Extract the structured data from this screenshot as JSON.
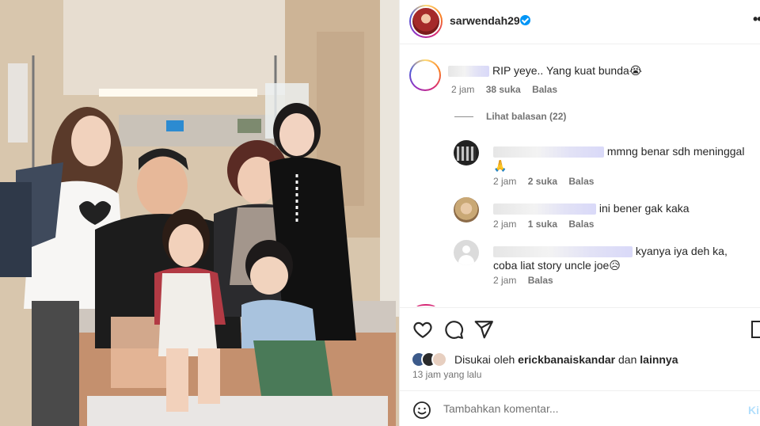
{
  "post": {
    "username": "sarwendah29",
    "more_label": "•••"
  },
  "comments": {
    "main": {
      "text": "RIP yeye.. Yang kuat bunda😭",
      "time": "2 jam",
      "likes": "38 suka",
      "reply": "Balas"
    },
    "view_replies": "Lihat balasan (22)",
    "replies": [
      {
        "text": "mmng benar sdh meninggal 🙏",
        "time": "2 jam",
        "likes": "2 suka",
        "reply": "Balas"
      },
      {
        "text": "ini bener gak kaka",
        "time": "2 jam",
        "likes": "1 suka",
        "reply": "Balas"
      },
      {
        "text": "kyanya iya deh ka, coba liat story uncle joe😥",
        "time": "2 jam",
        "reply": "Balas"
      }
    ]
  },
  "actions": {
    "icons": [
      "heart-icon",
      "comment-icon",
      "share-icon",
      "bookmark-icon"
    ],
    "liked_by_prefix": "Disukai oleh",
    "liked_by_user": "erickbanaiskandar",
    "liked_by_conj": "dan",
    "liked_by_others": "lainnya",
    "time_ago": "13 jam yang lalu"
  },
  "composer": {
    "placeholder": "Tambahkan komentar...",
    "post_label": "Kirim"
  },
  "colors": {
    "accent": "#0095f6",
    "text": "#262626",
    "muted": "#737373",
    "border": "#efefef"
  }
}
